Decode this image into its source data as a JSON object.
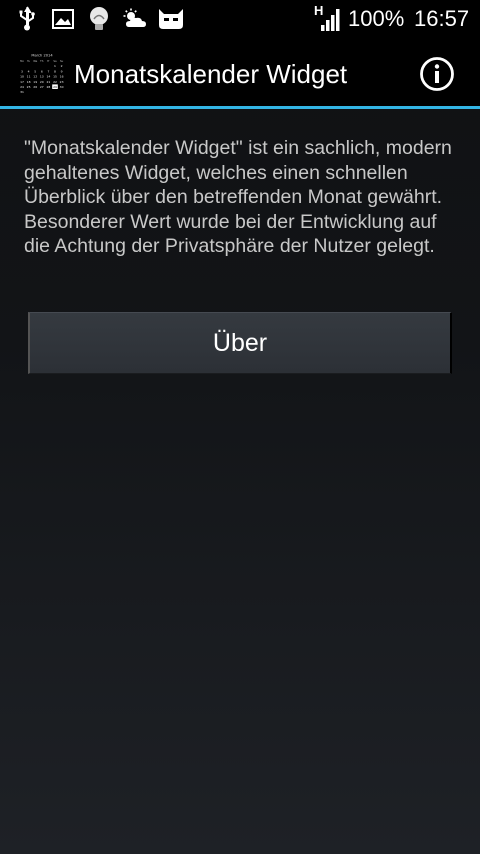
{
  "status_bar": {
    "network_type": "H",
    "battery": "100%",
    "time": "16:57",
    "icons": [
      "usb-icon",
      "image-icon",
      "lightbulb-icon",
      "weather-icon",
      "cyanogenmod-icon",
      "signal-icon"
    ]
  },
  "action_bar": {
    "title": "Monatskalender Widget",
    "app_icon": "calendar-icon",
    "action_icon": "info-icon",
    "accent_color": "#33b5e5",
    "app_icon_text": {
      "month": "March 2014",
      "weekdays": [
        "Mo",
        "Tu",
        "We",
        "Th",
        "Fr",
        "Sa",
        "Su"
      ],
      "rows": [
        [
          "",
          "",
          "",
          "",
          "",
          "1",
          "2"
        ],
        [
          "3",
          "4",
          "5",
          "6",
          "7",
          "8",
          "9"
        ],
        [
          "10",
          "11",
          "12",
          "13",
          "14",
          "15",
          "16"
        ],
        [
          "17",
          "18",
          "19",
          "20",
          "21",
          "22",
          "23"
        ],
        [
          "24",
          "25",
          "26",
          "27",
          "28",
          "29",
          "30"
        ],
        [
          "31",
          "",
          "",
          "",
          "",
          "",
          ""
        ]
      ]
    }
  },
  "content": {
    "description": "\"Monatskalender Widget\" ist ein sachlich, modern gehaltenes Widget, welches einen schnellen Überblick über den betreffenden Monat gewährt. Besonderer Wert wurde bei der Entwicklung auf die Achtung der Privatsphäre der Nutzer gelegt.",
    "about_button_label": "Über"
  }
}
